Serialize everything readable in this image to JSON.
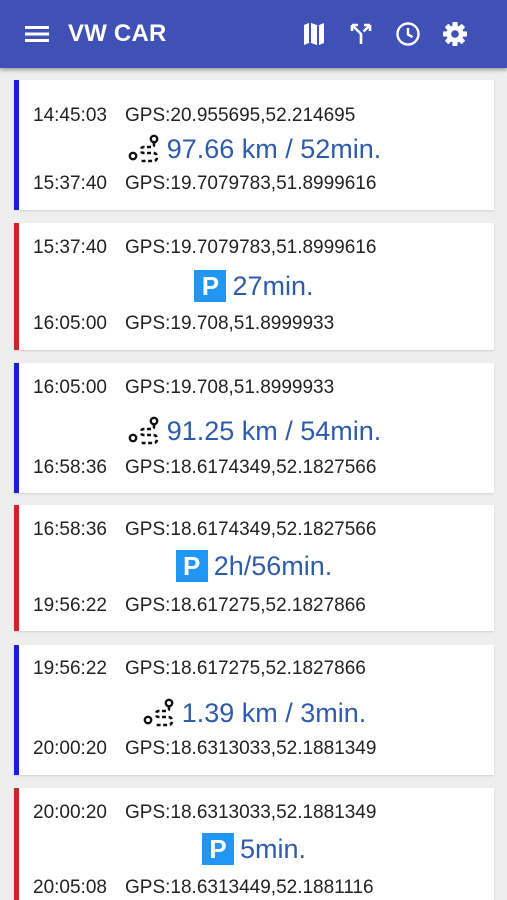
{
  "app": {
    "title": "VW CAR"
  },
  "toolbar": {
    "icons": [
      "menu-icon",
      "map-icon",
      "route-fork-icon",
      "clock-icon",
      "settings-gear-icon"
    ]
  },
  "colors": {
    "appbar": "#3f51b5",
    "drive_bar": "#1a1fd6",
    "park_bar": "#c62828",
    "value_text": "#2e5caa",
    "parking_icon": "#2196f3"
  },
  "entries": [
    {
      "kind": "drive",
      "start_time": "14:45:03",
      "start_gps": "GPS:20.955695,52.214695",
      "value": "97.66 km / 52min.",
      "end_time": "15:37:40",
      "end_gps": "GPS:19.7079783,51.8999616"
    },
    {
      "kind": "park",
      "start_time": "15:37:40",
      "start_gps": "GPS:19.7079783,51.8999616",
      "value": "27min.",
      "end_time": "16:05:00",
      "end_gps": "GPS:19.708,51.8999933"
    },
    {
      "kind": "drive",
      "start_time": "16:05:00",
      "start_gps": "GPS:19.708,51.8999933",
      "value": "91.25 km / 54min.",
      "end_time": "16:58:36",
      "end_gps": "GPS:18.6174349,52.1827566"
    },
    {
      "kind": "park",
      "start_time": "16:58:36",
      "start_gps": "GPS:18.6174349,52.1827566",
      "value": "2h/56min.",
      "end_time": "19:56:22",
      "end_gps": "GPS:18.617275,52.1827866"
    },
    {
      "kind": "drive",
      "start_time": "19:56:22",
      "start_gps": "GPS:18.617275,52.1827866",
      "value": "1.39 km / 3min.",
      "end_time": "20:00:20",
      "end_gps": "GPS:18.6313033,52.1881349"
    },
    {
      "kind": "park",
      "start_time": "20:00:20",
      "start_gps": "GPS:18.6313033,52.1881349",
      "value": "5min.",
      "end_time": "20:05:08",
      "end_gps": "GPS:18.6313449,52.1881116"
    }
  ],
  "parking_icon_letter": "P"
}
